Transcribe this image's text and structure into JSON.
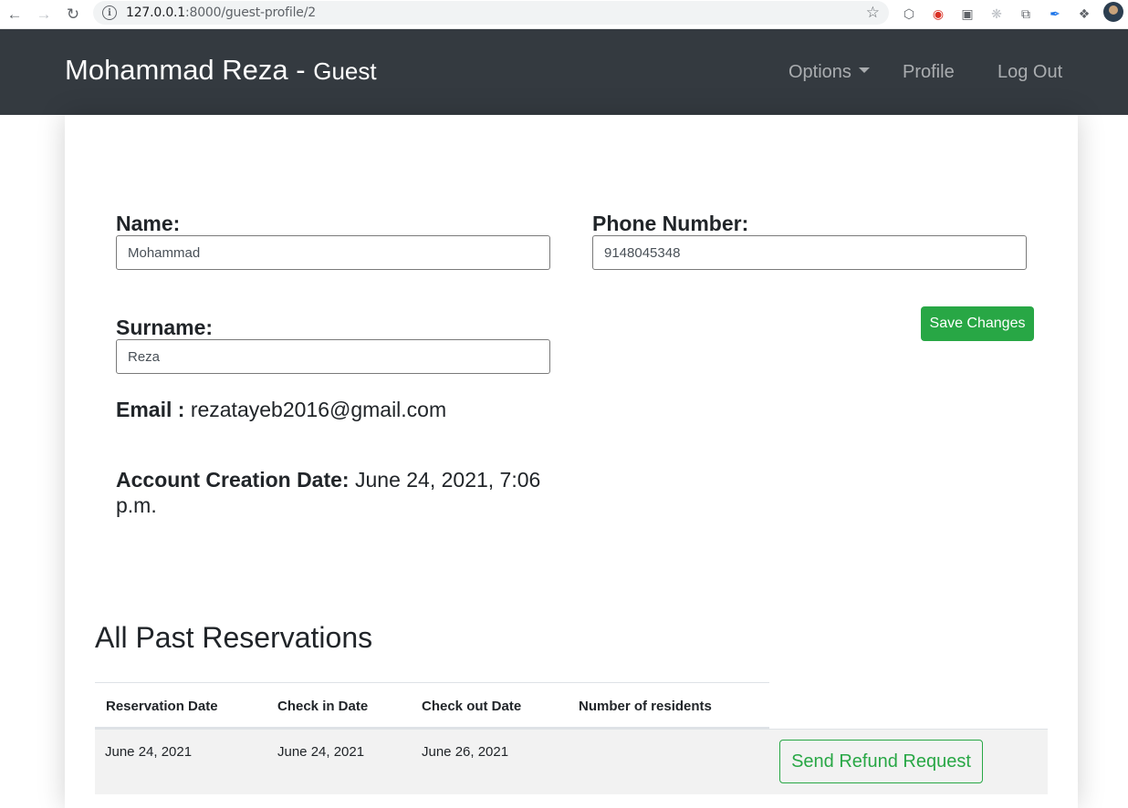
{
  "browser": {
    "url_host": "127.0.0.1",
    "url_path": ":8000/guest-profile/2"
  },
  "navbar": {
    "name": "Mohammad Reza",
    "separator": " - ",
    "role": "Guest",
    "options_label": "Options",
    "profile_label": "Profile",
    "logout_label": "Log Out"
  },
  "form": {
    "name_label": "Name:",
    "name_value": "Mohammad",
    "phone_label": "Phone Number:",
    "phone_value": "9148045348",
    "surname_label": "Surname:",
    "surname_value": "Reza",
    "save_label": "Save Changes"
  },
  "info": {
    "email_label": "Email :",
    "email_value": "rezatayeb2016@gmail.com",
    "created_label": "Account Creation Date:",
    "created_value": "June 24, 2021, 7:06 p.m."
  },
  "reservations": {
    "title": "All Past Reservations",
    "columns": [
      "Reservation Date",
      "Check in Date",
      "Check out Date",
      "Number of residents"
    ],
    "rows": [
      {
        "reservation_date": "June 24, 2021",
        "check_in": "June 24, 2021",
        "check_out": "June 26, 2021",
        "residents": ""
      }
    ],
    "refund_label": "Send Refund Request"
  },
  "theme": {
    "navbar_bg": "#343a40",
    "success": "#28a745"
  }
}
